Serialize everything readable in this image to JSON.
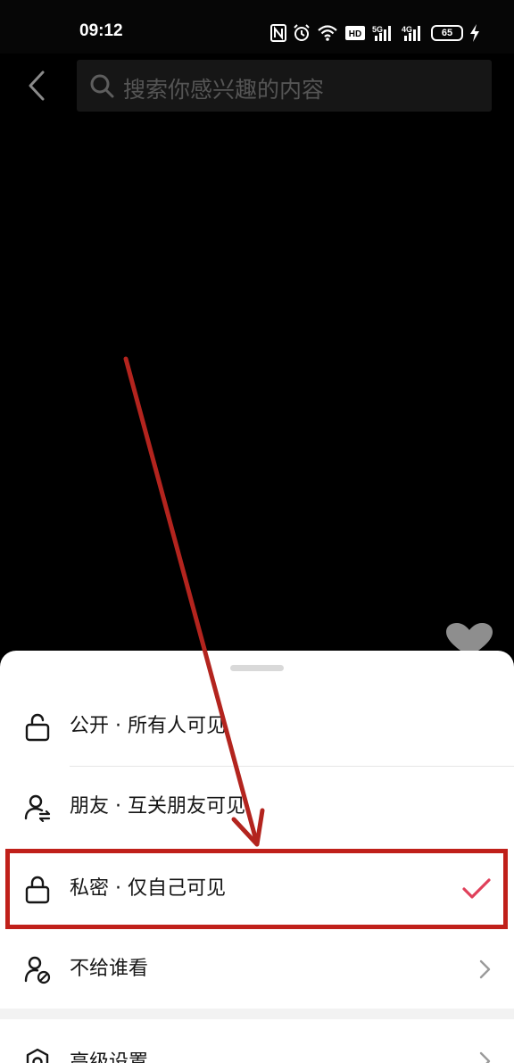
{
  "status_bar": {
    "time": "09:12",
    "battery_level": "65",
    "icons": [
      "nfc-icon",
      "alarm-icon",
      "wifi-icon",
      "hd-icon",
      "signal-5g-icon",
      "signal-4g-icon",
      "battery-icon",
      "charging-icon"
    ],
    "signal_labels": {
      "hd": "HD",
      "five_g": "5G",
      "four_g": "4G"
    }
  },
  "header": {
    "search_placeholder": "搜索你感兴趣的内容"
  },
  "visibility_sheet": {
    "options": [
      {
        "label": "公开 · 所有人可见",
        "icon": "unlock-icon",
        "selected": false,
        "has_chevron": false
      },
      {
        "label": "朋友 · 互关朋友可见",
        "icon": "friends-icon",
        "selected": false,
        "has_chevron": false
      },
      {
        "label": "私密 · 仅自己可见",
        "icon": "lock-icon",
        "selected": true,
        "has_chevron": false
      },
      {
        "label": "不给谁看",
        "icon": "user-block-icon",
        "selected": false,
        "has_chevron": true
      }
    ],
    "advanced": {
      "label": "高级设置",
      "icon": "settings-icon",
      "has_chevron": true
    }
  },
  "colors": {
    "accent_check": "#e0405a",
    "annotation_red": "#c0201a",
    "sheet_bg": "#ffffff",
    "text": "#161616"
  }
}
